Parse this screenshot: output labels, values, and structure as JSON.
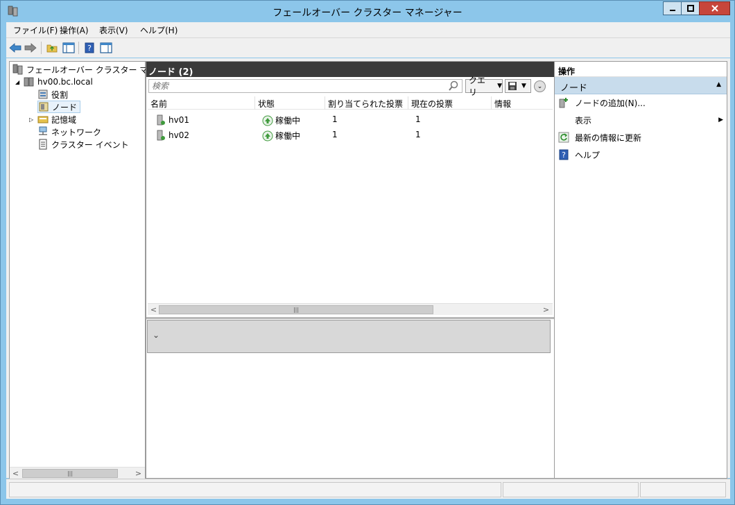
{
  "window": {
    "title": "フェールオーバー クラスター マネージャー"
  },
  "menu": [
    "ファイル(F)",
    "操作(A)",
    "表示(V)",
    "ヘルプ(H)"
  ],
  "tree": {
    "root": "フェールオーバー クラスター マネージャ",
    "cluster": "hv00.bc.local",
    "items": [
      "役割",
      "ノード",
      "記憶域",
      "ネットワーク",
      "クラスター イベント"
    ]
  },
  "center": {
    "header": "ノード (2)",
    "search_placeholder": "検索",
    "query_label": "クエリ",
    "columns": [
      "名前",
      "状態",
      "割り当てられた投票",
      "現在の投票",
      "情報"
    ],
    "rows": [
      {
        "name": "hv01",
        "status": "稼働中",
        "assigned_votes": "1",
        "current_votes": "1"
      },
      {
        "name": "hv02",
        "status": "稼働中",
        "assigned_votes": "1",
        "current_votes": "1"
      }
    ]
  },
  "actions": {
    "header": "操作",
    "group": "ノード",
    "items": [
      "ノードの追加(N)...",
      "表示",
      "最新の情報に更新",
      "ヘルプ"
    ]
  },
  "colors": {
    "window_frame": "#8cc6ea",
    "header_dark": "#3a3a3a",
    "action_group": "#c8dcec",
    "status_ok": "#3f9a3c",
    "close_button": "#c7463b"
  }
}
